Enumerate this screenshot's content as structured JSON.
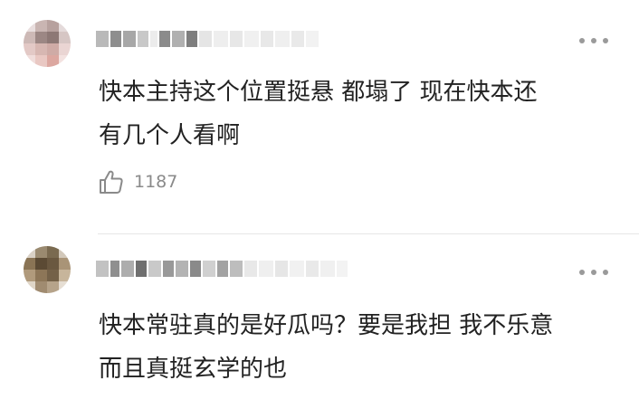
{
  "comments": [
    {
      "text_line1": "快本主持这个位置挺悬 都塌了 现在快本还",
      "text_line2": "有几个人看啊",
      "like_count": "1187",
      "more_icon": "more-dots-icon",
      "like_icon": "thumbs-up-icon"
    },
    {
      "text_line1": "快本常驻真的是好瓜吗？要是我担 我不乐意",
      "text_line2": "而且真挺玄学的也",
      "more_icon": "more-dots-icon"
    }
  ],
  "colors": {
    "text": "#222222",
    "meta": "#8a8a8a",
    "divider": "#e6e6e6",
    "dots": "#9a9a9a"
  }
}
